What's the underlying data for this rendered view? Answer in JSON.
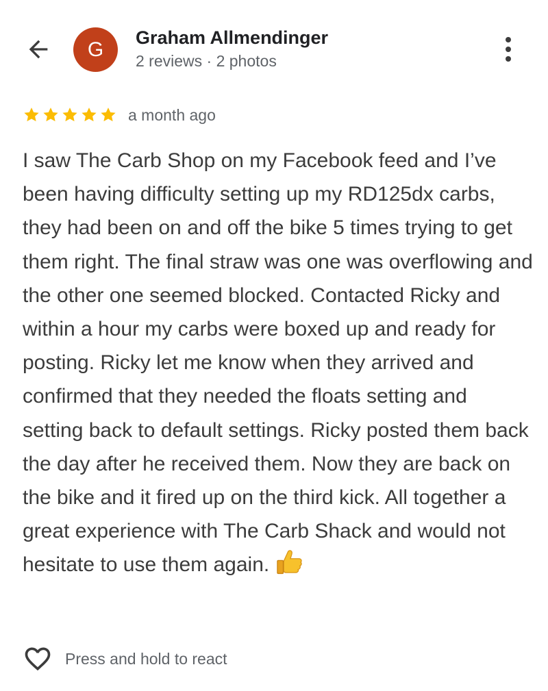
{
  "header": {
    "back_icon": "arrow-back-icon",
    "avatar_letter": "G",
    "avatar_color": "#c1401a",
    "reviewer_name": "Graham Allmendinger",
    "reviewer_meta": "2 reviews · 2 photos",
    "more_icon": "more-vert-icon"
  },
  "review": {
    "rating": 5,
    "rating_max": 5,
    "star_color": "#fbbc04",
    "time": "a month ago",
    "text": "I saw The Carb Shop on my Facebook feed and I’ve been having difficulty setting up my RD125dx carbs, they had been on and off the bike 5 times trying to get them right. The final straw was one was overflowing and the other one seemed blocked. Contacted Ricky and within a hour my carbs were boxed up and ready for posting. Ricky let me know when they arrived and confirmed that they needed the floats setting and setting back to default settings. Ricky posted them back the day after he received them. Now they are back on the bike and it fired up on the third kick. All together a great experience with The Carb Shack and would not hesitate to use them again.",
    "emoji": "thumbs-up-icon"
  },
  "footer": {
    "heart_icon": "heart-outline-icon",
    "react_hint": "Press and hold to react"
  }
}
